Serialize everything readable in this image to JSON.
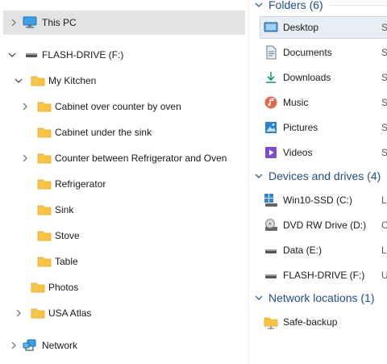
{
  "nav_tree": {
    "this_pc": {
      "label": "This PC",
      "icon": "monitor-icon"
    },
    "flash_drive": {
      "label": "FLASH-DRIVE (F:)",
      "icon": "usb-drive-icon"
    },
    "my_kitchen": {
      "label": "My Kitchen",
      "icon": "folder-icon"
    },
    "kitchen_children": [
      {
        "label": "Cabinet over counter by oven",
        "expandable": true
      },
      {
        "label": "Cabinet under the sink",
        "expandable": false
      },
      {
        "label": "Counter between Refrigerator and Oven",
        "expandable": true
      },
      {
        "label": "Refrigerator",
        "expandable": false
      },
      {
        "label": "Sink",
        "expandable": false
      },
      {
        "label": "Stove",
        "expandable": false
      },
      {
        "label": "Table",
        "expandable": false
      }
    ],
    "photos": {
      "label": "Photos"
    },
    "usa_atlas": {
      "label": "USA Atlas"
    },
    "network": {
      "label": "Network",
      "icon": "network-icon"
    }
  },
  "content": {
    "groups": [
      {
        "title": "Folders (6)",
        "items": [
          {
            "label": "Desktop",
            "extra": "S",
            "icon": "desktop-folder-icon",
            "color": "#4a90d9"
          },
          {
            "label": "Documents",
            "extra": "S",
            "icon": "documents-icon",
            "color": "#6b7f99"
          },
          {
            "label": "Downloads",
            "extra": "S",
            "icon": "downloads-icon",
            "color": "#1e9e6b"
          },
          {
            "label": "Music",
            "extra": "S",
            "icon": "music-icon",
            "color": "#e06a4e"
          },
          {
            "label": "Pictures",
            "extra": "S",
            "icon": "pictures-icon",
            "color": "#2b7fd1"
          },
          {
            "label": "Videos",
            "extra": "S",
            "icon": "videos-icon",
            "color": "#7a4fc9"
          }
        ]
      },
      {
        "title": "Devices and drives (4)",
        "items": [
          {
            "label": "Win10-SSD (C:)",
            "extra": "L",
            "icon": "windows-drive-icon"
          },
          {
            "label": "DVD RW Drive (D:)",
            "extra": "C",
            "icon": "dvd-drive-icon"
          },
          {
            "label": "Data (E:)",
            "extra": "L",
            "icon": "drive-icon"
          },
          {
            "label": "FLASH-DRIVE (F:)",
            "extra": "U",
            "icon": "usb-drive-icon"
          }
        ]
      },
      {
        "title": "Network locations (1)",
        "items": [
          {
            "label": "Safe-backup",
            "extra": "",
            "icon": "network-folder-icon"
          }
        ]
      }
    ]
  },
  "colors": {
    "folder": "#f8c542",
    "folder_dark": "#e8a91c",
    "group_title": "#1f4f8b",
    "selection": "#e3e3e3"
  }
}
